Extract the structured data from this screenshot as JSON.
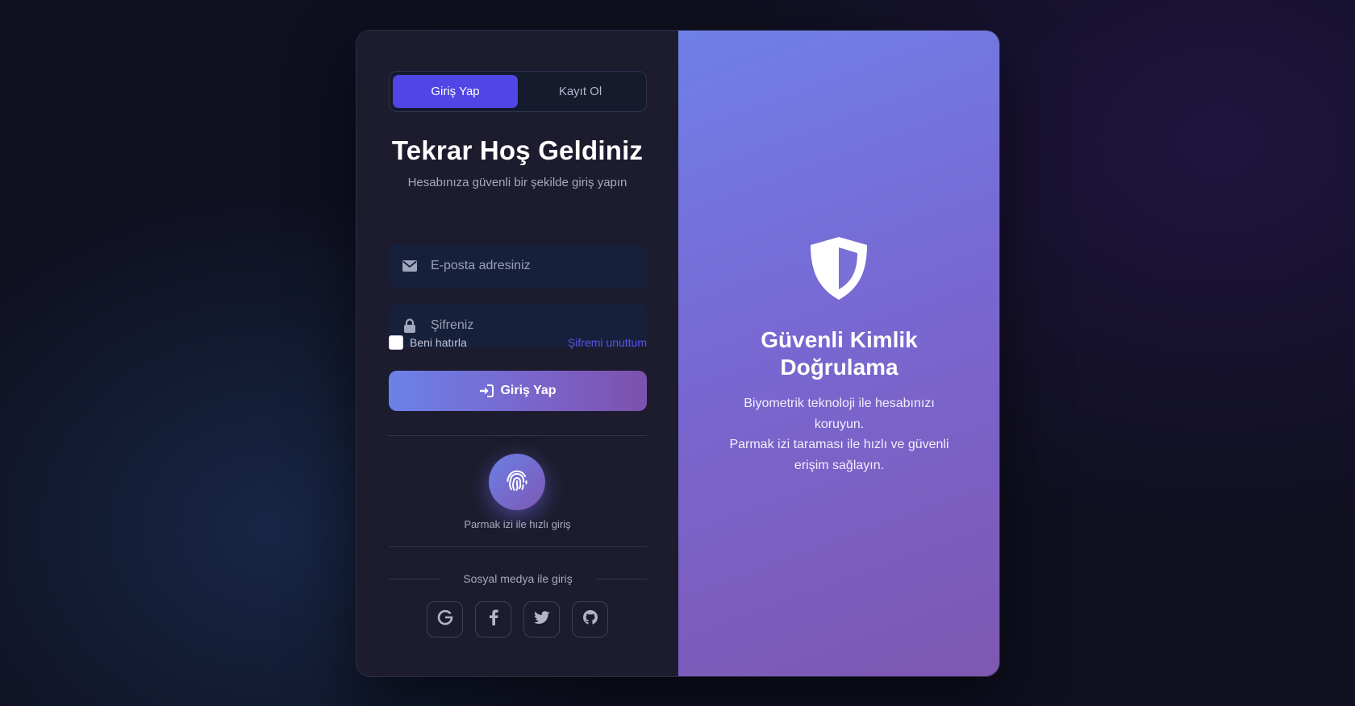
{
  "tabs": {
    "login": "Giriş Yap",
    "register": "Kayıt Ol"
  },
  "header": {
    "title": "Tekrar Hoş Geldiniz",
    "subtitle": "Hesabınıza güvenli bir şekilde giriş yapın"
  },
  "form": {
    "email_placeholder": "E-posta adresiniz",
    "email_icon": "envelope-icon",
    "password_placeholder": "Şifreniz",
    "password_icon": "lock-icon",
    "remember_label": "Beni hatırla",
    "remember_checked": false,
    "forgot_label": "Şifremi unuttum",
    "submit_label": "Giriş Yap",
    "submit_icon": "sign-in-icon"
  },
  "fingerprint": {
    "label": "Parmak izi ile hızlı giriş",
    "icon": "fingerprint-icon"
  },
  "social": {
    "title": "Sosyal medya ile giriş",
    "providers": [
      "google-icon",
      "facebook-icon",
      "twitter-icon",
      "github-icon"
    ]
  },
  "promo": {
    "icon": "shield-icon",
    "title_line1": "Güvenli Kimlik",
    "title_line2": "Doğrulama",
    "desc_line1": "Biyometrik teknoloji ile hesabınızı koruyun.",
    "desc_line2": "Parmak izi taraması ile hızlı ve güvenli erişim sağlayın."
  },
  "colors": {
    "accent": "#4f46e5",
    "link": "#5b52ea",
    "panel_bg": "#1c1c2e",
    "gradient_start": "#6f80e8",
    "gradient_end": "#7e57b2"
  }
}
